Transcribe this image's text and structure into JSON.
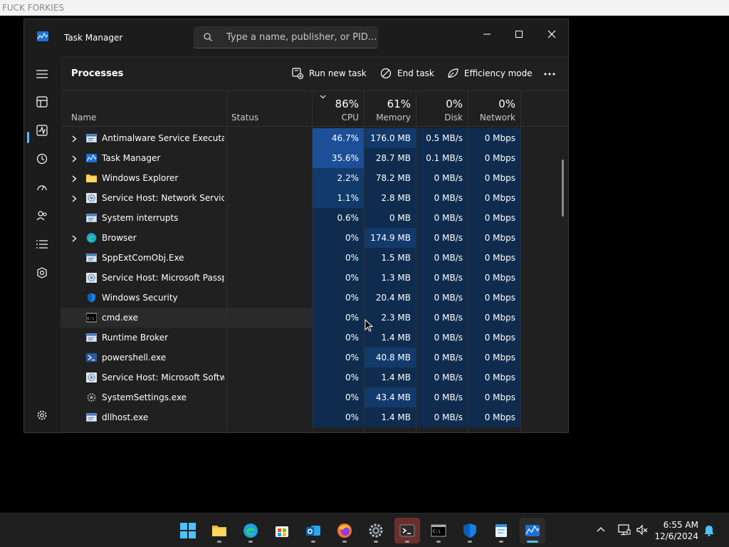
{
  "topbar": {
    "text": "FUCK FORKIES"
  },
  "window": {
    "title": "Task Manager",
    "search_placeholder": "Type a name, publisher, or PID..."
  },
  "toolbar": {
    "title": "Processes",
    "run_new_task": "Run new task",
    "end_task": "End task",
    "efficiency_mode": "Efficiency mode"
  },
  "columns": {
    "name": "Name",
    "status": "Status",
    "cpu": {
      "pct": "86%",
      "label": "CPU"
    },
    "memory": {
      "pct": "61%",
      "label": "Memory"
    },
    "disk": {
      "pct": "0%",
      "label": "Disk"
    },
    "network": {
      "pct": "0%",
      "label": "Network"
    }
  },
  "processes": [
    {
      "name": "Antimalware Service Executable",
      "expandable": true,
      "icon": "app-window-icon",
      "cpu": "46.7%",
      "memory": "176.0 MB",
      "disk": "0.5 MB/s",
      "network": "0 Mbps",
      "cpu_heat": 3,
      "mem_heat": 2,
      "disk_heat": 1
    },
    {
      "name": "Task Manager",
      "expandable": true,
      "icon": "task-manager-icon",
      "cpu": "35.6%",
      "memory": "28.7 MB",
      "disk": "0.1 MB/s",
      "network": "0 Mbps",
      "cpu_heat": 3,
      "mem_heat": 1,
      "disk_heat": 1
    },
    {
      "name": "Windows Explorer",
      "expandable": true,
      "icon": "folder-icon",
      "cpu": "2.2%",
      "memory": "78.2 MB",
      "disk": "0 MB/s",
      "network": "0 Mbps",
      "cpu_heat": 2,
      "mem_heat": 1,
      "disk_heat": 1
    },
    {
      "name": "Service Host: Network Service",
      "expandable": true,
      "icon": "gear-icon",
      "cpu": "1.1%",
      "memory": "2.8 MB",
      "disk": "0 MB/s",
      "network": "0 Mbps",
      "cpu_heat": 2,
      "mem_heat": 1,
      "disk_heat": 1
    },
    {
      "name": "System interrupts",
      "expandable": false,
      "icon": "app-window-icon",
      "cpu": "0.6%",
      "memory": "0 MB",
      "disk": "0 MB/s",
      "network": "0 Mbps",
      "cpu_heat": 1,
      "mem_heat": 1,
      "disk_heat": 1
    },
    {
      "name": "Browser",
      "expandable": true,
      "icon": "edge-icon",
      "cpu": "0%",
      "memory": "174.9 MB",
      "disk": "0 MB/s",
      "network": "0 Mbps",
      "cpu_heat": 1,
      "mem_heat": 2,
      "disk_heat": 1
    },
    {
      "name": "SppExtComObj.Exe",
      "expandable": false,
      "icon": "app-window-icon",
      "cpu": "0%",
      "memory": "1.5 MB",
      "disk": "0 MB/s",
      "network": "0 Mbps",
      "cpu_heat": 1,
      "mem_heat": 1,
      "disk_heat": 1
    },
    {
      "name": "Service Host: Microsoft Passp...",
      "expandable": false,
      "icon": "gear-icon",
      "cpu": "0%",
      "memory": "1.3 MB",
      "disk": "0 MB/s",
      "network": "0 Mbps",
      "cpu_heat": 1,
      "mem_heat": 1,
      "disk_heat": 1
    },
    {
      "name": "Windows Security",
      "expandable": false,
      "icon": "shield-icon",
      "cpu": "0%",
      "memory": "20.4 MB",
      "disk": "0 MB/s",
      "network": "0 Mbps",
      "cpu_heat": 1,
      "mem_heat": 1,
      "disk_heat": 1
    },
    {
      "name": "cmd.exe",
      "expandable": false,
      "icon": "console-icon",
      "cpu": "0%",
      "memory": "2.3 MB",
      "disk": "0 MB/s",
      "network": "0 Mbps",
      "cpu_heat": 1,
      "mem_heat": 1,
      "disk_heat": 1
    },
    {
      "name": "Runtime Broker",
      "expandable": false,
      "icon": "app-window-icon",
      "cpu": "0%",
      "memory": "1.4 MB",
      "disk": "0 MB/s",
      "network": "0 Mbps",
      "cpu_heat": 1,
      "mem_heat": 1,
      "disk_heat": 1
    },
    {
      "name": "powershell.exe",
      "expandable": false,
      "icon": "powershell-icon",
      "cpu": "0%",
      "memory": "40.8 MB",
      "disk": "0 MB/s",
      "network": "0 Mbps",
      "cpu_heat": 1,
      "mem_heat": 2,
      "disk_heat": 1
    },
    {
      "name": "Service Host: Microsoft Softw...",
      "expandable": false,
      "icon": "gear-icon",
      "cpu": "0%",
      "memory": "1.4 MB",
      "disk": "0 MB/s",
      "network": "0 Mbps",
      "cpu_heat": 1,
      "mem_heat": 1,
      "disk_heat": 1
    },
    {
      "name": "SystemSettings.exe",
      "expandable": false,
      "icon": "settings-gear-icon",
      "cpu": "0%",
      "memory": "43.4 MB",
      "disk": "0 MB/s",
      "network": "0 Mbps",
      "cpu_heat": 1,
      "mem_heat": 2,
      "disk_heat": 1
    },
    {
      "name": "dllhost.exe",
      "expandable": false,
      "icon": "app-window-icon",
      "cpu": "0%",
      "memory": "1.4 MB",
      "disk": "0 MB/s",
      "network": "0 Mbps",
      "cpu_heat": 1,
      "mem_heat": 1,
      "disk_heat": 1
    }
  ],
  "heat_colors": {
    "1": "#0f2c4f",
    "2": "#123a6b",
    "3": "#1c4f97"
  },
  "highlight_row": "cmd.exe",
  "sidebar": [
    "hamburger-menu-icon",
    "processes-icon",
    "performance-icon",
    "app-history-icon",
    "startup-apps-icon",
    "users-icon",
    "details-icon",
    "services-icon",
    "settings-icon"
  ],
  "taskbar": {
    "apps": [
      "windows-start-icon",
      "file-explorer-icon",
      "edge-icon",
      "microsoft-store-icon",
      "outlook-icon",
      "firefox-icon",
      "settings-icon",
      "terminal-icon",
      "cmd-icon",
      "windows-security-icon",
      "notepad-icon",
      "task-manager-icon"
    ],
    "time": "6:55 AM",
    "date": "12/6/2024"
  },
  "accent": "#4cc2ff"
}
